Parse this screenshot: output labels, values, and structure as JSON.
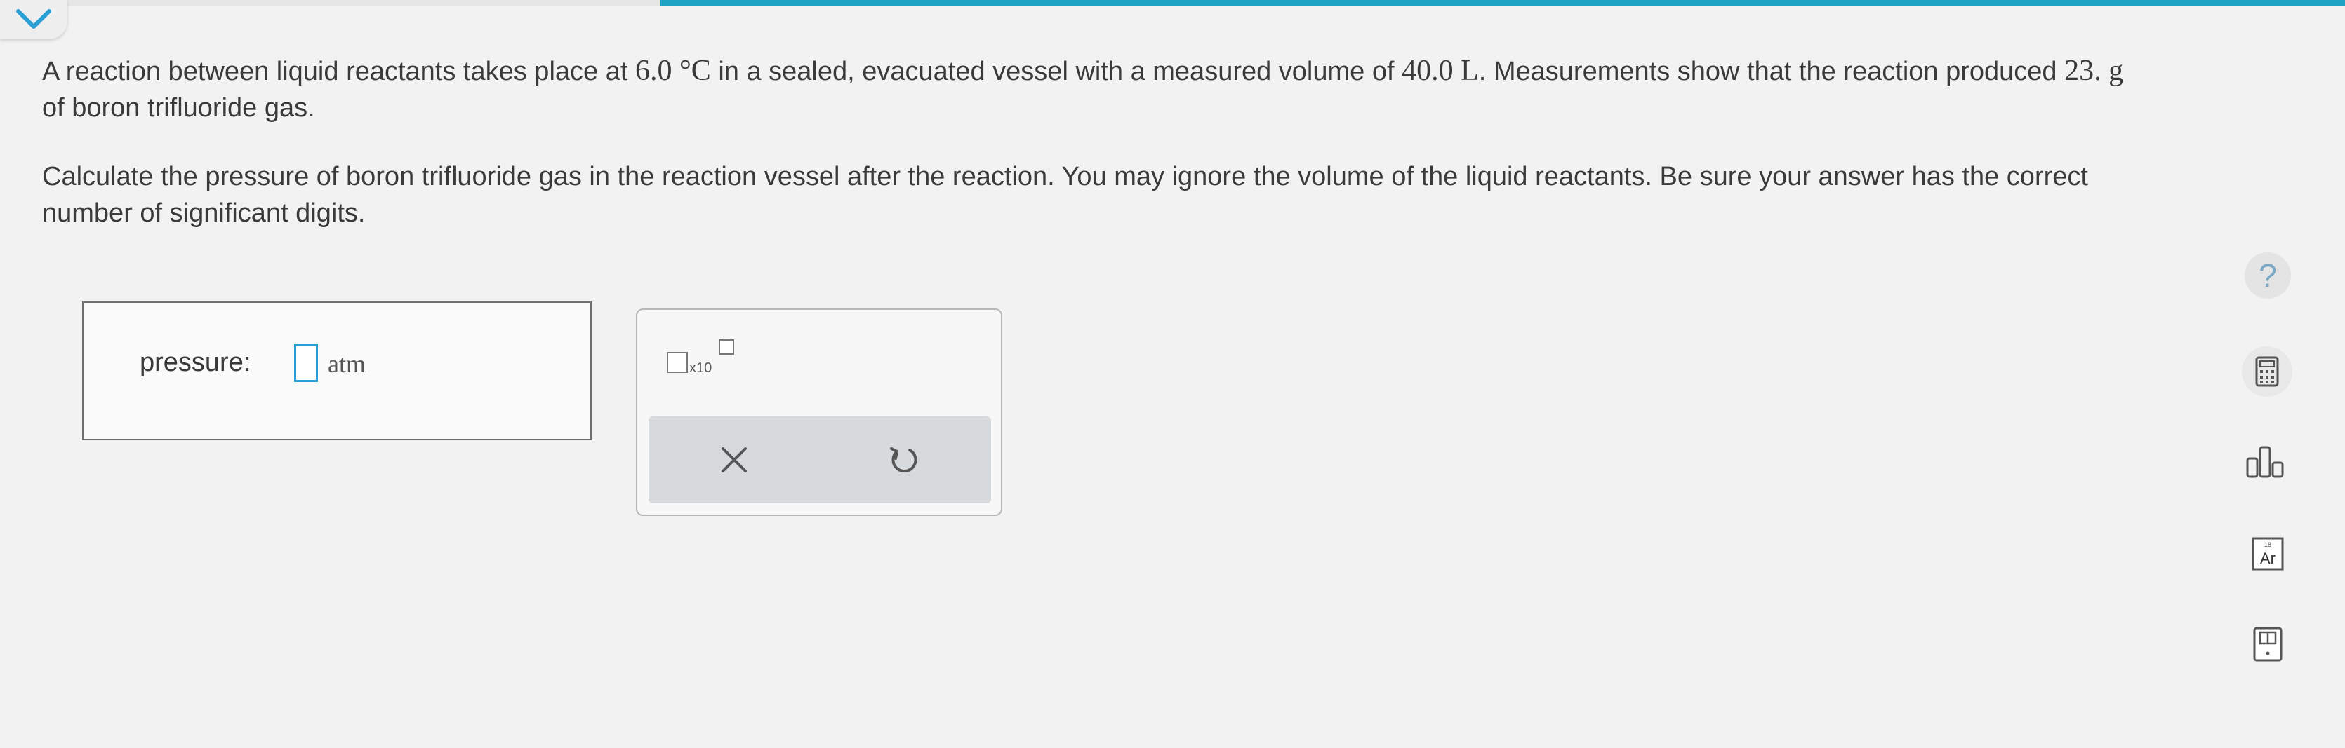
{
  "header": {
    "collapse_icon": "chevron-down-icon",
    "accent_color": "#1fa3c4"
  },
  "question": {
    "p1": {
      "t1": "A reaction between liquid reactants takes place at ",
      "v1": "6.0 °C",
      "t2": " in a sealed, evacuated vessel with a measured volume of ",
      "v2": "40.0 L",
      "t3": ". Measurements show that the reaction produced ",
      "v3": "23. g",
      "t4": " of boron trifluoride gas."
    },
    "p2": "Calculate the pressure of boron trifluoride gas in the reaction vessel after the reaction. You may ignore the volume of the liquid reactants. Be sure your answer has the correct number of significant digits."
  },
  "answer": {
    "label": "pressure:",
    "value": "",
    "unit": "atm"
  },
  "toolpanel": {
    "sci_notation_times": "x10",
    "clear_icon": "x-icon",
    "undo_icon": "undo-icon"
  },
  "sidebar": {
    "help_label": "?",
    "calculator_icon": "calculator-icon",
    "chart_icon": "bar-chart-icon",
    "periodic_table_icon": "periodic-table-icon",
    "periodic_symbol": "Ar",
    "periodic_number": "18",
    "reference_icon": "reference-book-icon"
  }
}
